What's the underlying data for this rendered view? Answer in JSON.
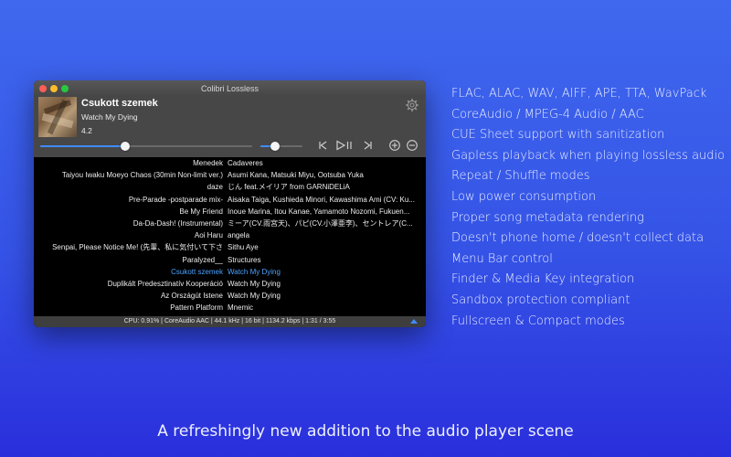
{
  "window": {
    "title": "Colibri Lossless"
  },
  "now_playing": {
    "title": "Csukott szemek",
    "artist": "Watch My Dying",
    "rating": "4.2",
    "progress": 0.4,
    "volume": 0.35
  },
  "icons": {
    "settings": "gear-icon",
    "previous": "skip-previous-icon",
    "play_pause": "play-pause-icon",
    "next": "skip-next-icon",
    "add": "plus-circle-icon",
    "remove": "minus-circle-icon"
  },
  "colors": {
    "accent": "#3f8cff",
    "playing_text": "#4aa1ff",
    "background_top": "#3f68ee",
    "background_bottom": "#2a2fdc"
  },
  "playlist": [
    {
      "title": "Menedek",
      "artist": "Cadaveres",
      "playing": false
    },
    {
      "title": "Taiyou Iwaku Moeyo Chaos (30min Non-limit ver.)",
      "artist": "Asumi Kana, Matsuki Miyu, Ootsuba Yuka",
      "playing": false
    },
    {
      "title": "daze",
      "artist": "じん feat.メイリア from GARNiDELiA",
      "playing": false
    },
    {
      "title": "Pre-Parade -postparade mix-",
      "artist": "Aisaka Taiga, Kushieda Minori, Kawashima Ami (CV: Ku...",
      "playing": false
    },
    {
      "title": "Be My Friend",
      "artist": "Inoue Marina, Itou Kanae, Yamamoto Nozomi, Fukuen...",
      "playing": false
    },
    {
      "title": "Da-Da-Dash! (Instrumental)",
      "artist": "ミーア(CV.雨宮天)、パピ(CV.小澤亜李)、セントレア(C...",
      "playing": false
    },
    {
      "title": "Aoi Haru",
      "artist": "angela",
      "playing": false
    },
    {
      "title": "Senpai, Please Notice Me! (先輩、私に気付いて下さ",
      "artist": "Sithu Aye",
      "playing": false
    },
    {
      "title": "Paralyzed__",
      "artist": "Structures",
      "playing": false
    },
    {
      "title": "Csukott szemek",
      "artist": "Watch My Dying",
      "playing": true
    },
    {
      "title": "Duplikált Predesztinatív Kooperáció",
      "artist": "Watch My Dying",
      "playing": false
    },
    {
      "title": "Az Országút Istene",
      "artist": "Watch My Dying",
      "playing": false
    },
    {
      "title": "Pattern Platform",
      "artist": "Mnemic",
      "playing": false
    }
  ],
  "status": {
    "text": "CPU: 0.91% | CoreAudio AAC | 44.1 kHz | 16 bit | 1134.2 kbps | 1:31 / 3:55"
  },
  "features": [
    "FLAC, ALAC, WAV, AIFF, APE, TTA, WavPack",
    "CoreAudio / MPEG-4 Audio / AAC",
    "CUE Sheet support with sanitization",
    "Gapless playback when playing lossless audio",
    "Repeat / Shuffle modes",
    "Low power consumption",
    "Proper song metadata rendering",
    "Doesn't phone home / doesn't collect data",
    "Menu Bar control",
    "Finder & Media Key integration",
    "Sandbox protection compliant",
    "Fullscreen & Compact modes"
  ],
  "tagline": "A refreshingly new addition to the audio player scene"
}
